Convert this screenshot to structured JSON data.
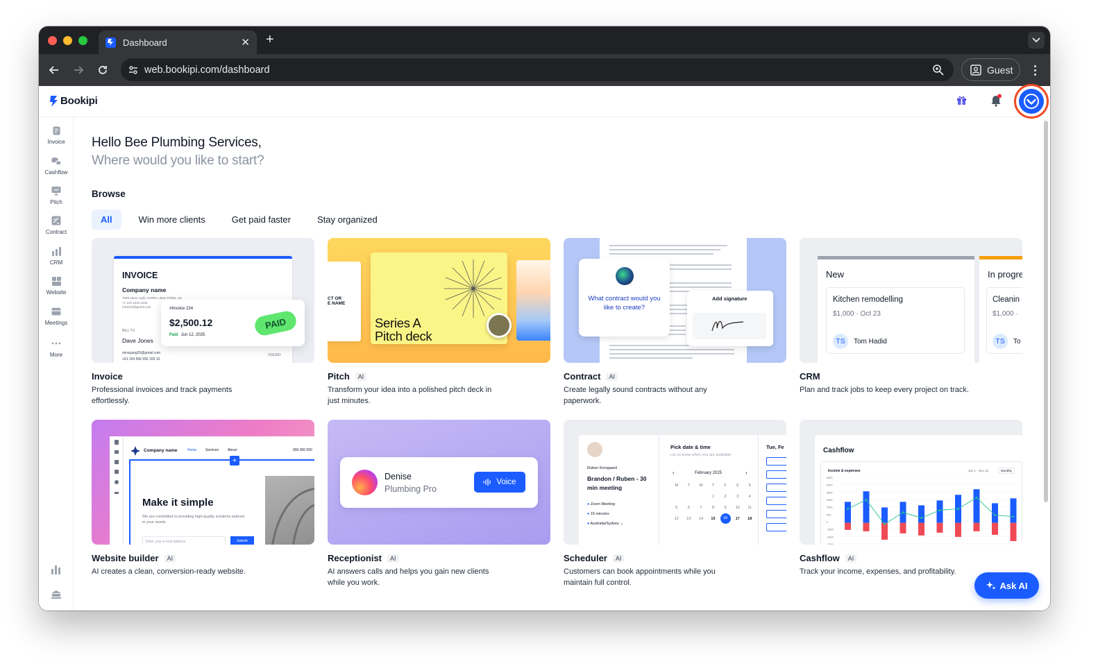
{
  "browser": {
    "tab_title": "Dashboard",
    "url": "web.bookipi.com/dashboard",
    "guest_label": "Guest"
  },
  "app": {
    "logo": "Bookipi"
  },
  "sidebar": {
    "items": [
      {
        "label": "Invoice",
        "icon": "invoice-icon"
      },
      {
        "label": "Cashflow",
        "icon": "cashflow-icon"
      },
      {
        "label": "Pitch",
        "icon": "pitch-icon"
      },
      {
        "label": "Contract",
        "icon": "contract-icon"
      },
      {
        "label": "CRM",
        "icon": "crm-icon"
      },
      {
        "label": "Website",
        "icon": "website-icon"
      },
      {
        "label": "Meetings",
        "icon": "meetings-icon"
      },
      {
        "label": "More",
        "icon": "more-icon"
      }
    ]
  },
  "main": {
    "greeting": "Hello Bee Plumbing Services,",
    "subgreeting": "Where would you like to start?",
    "browse_label": "Browse",
    "filters": [
      "All",
      "Win more clients",
      "Get paid faster",
      "Stay organized"
    ],
    "cards": [
      {
        "title": "Invoice",
        "ai": "",
        "desc": "Professional invoices and track payments effortlessly."
      },
      {
        "title": "Pitch",
        "ai": "AI",
        "desc": "Transform your idea into a polished pitch deck in just minutes."
      },
      {
        "title": "Contract",
        "ai": "AI",
        "desc": "Create legally sound contracts without any paperwork."
      },
      {
        "title": "CRM",
        "ai": "",
        "desc": "Plan and track jobs to keep every project on track."
      },
      {
        "title": "Website builder",
        "ai": "AI",
        "desc": "AI creates a clean, conversion-ready website."
      },
      {
        "title": "Receptionist",
        "ai": "AI",
        "desc": "AI answers calls and helps you gain new clients while you work."
      },
      {
        "title": "Scheduler",
        "ai": "AI",
        "desc": "Customers can book appointments while you maintain full control."
      },
      {
        "title": "Cashflow",
        "ai": "AI",
        "desc": "Track your income, expenses, and profitability."
      }
    ]
  },
  "previews": {
    "invoice": {
      "heading": "INVOICE",
      "company": "Company name",
      "addr1": "7935 Jaron Light, Keeble Lakes 97535, US",
      "addr2": "+1 123 1234 1234",
      "addr3": "mir1234@gmail.com",
      "number": "#Invoice 234",
      "amount": "$2,500.12",
      "paid": "Paid",
      "date": "Jun 12, 2025",
      "stamp": "PAID",
      "bill_to": "BILL TO",
      "client": "Dave Jones",
      "client_email": "miracjang25@gmail.com",
      "client_phone": "+61 154 566 556 165 16",
      "issued": "ISSUED"
    },
    "pitch": {
      "line1": "Series A",
      "line2": "Pitch deck",
      "side1": "CT OR",
      "side2": "E NAME"
    },
    "contract": {
      "question": "What contract would you like to create?",
      "sign": "Add signature"
    },
    "crm": {
      "col1": "New",
      "col2": "In progre",
      "job1": "Kitchen remodelling",
      "job1_meta": "$1,000 · Oct 23",
      "avatar1": "TS",
      "person1": "Tom Hadid",
      "job2": "Cleanin",
      "job2_meta": "$1,000 ·",
      "avatar2": "TS",
      "person2": "To"
    },
    "website": {
      "company": "Company name",
      "nav1": "Home",
      "nav2": "Services",
      "nav3": "About",
      "phone": "000 000 000",
      "headline": "Make it simple",
      "body": "We are committed to providing high-quality solutions tailored to your needs.",
      "placeholder": "Enter your e-mail address",
      "submit": "Submit"
    },
    "receptionist": {
      "name": "Denise",
      "role": "Plumbing Pro",
      "voice": "Voice"
    },
    "scheduler": {
      "host": "Ruben Korsgaard",
      "event": "Brandon / Ruben - 30 min meeting",
      "loc": "Zoom Meeting",
      "dur": "15 minutes",
      "tz": "Australia/Sydney",
      "pick": "Pick date & time",
      "pick_sub": "Let us know when you are available.",
      "month": "February 2025",
      "side": "Tue, Fe",
      "dow": [
        "M",
        "T",
        "W",
        "T",
        "F",
        "S",
        "S"
      ],
      "days": [
        "",
        "",
        "",
        "1",
        "2",
        "3",
        "4",
        "5",
        "6",
        "7",
        "8",
        "9",
        "10",
        "11",
        "12",
        "13",
        "14",
        "15",
        "16",
        "17",
        "18"
      ]
    },
    "cashflow": {
      "title": "Cashflow",
      "panel": "Income & expenses",
      "range": "Jan 1 - Dec 31",
      "period": "Monthly",
      "yticks": [
        "6500",
        "5000",
        "3500",
        "2500",
        "1500",
        "500",
        "0",
        "-1500",
        "-2400",
        "-3000"
      ]
    }
  },
  "ask_ai": "Ask AI",
  "colors": {
    "brand": "#1a5cff",
    "profile_ring": "#f04a23",
    "paid_green": "#5ee66e",
    "income": "#1a5cff",
    "expense": "#f04a55",
    "net": "#22c08f"
  },
  "chart_data": {
    "type": "bar",
    "title": "Income & expenses",
    "series": [
      {
        "name": "",
        "values": [
          3000,
          4500,
          2200,
          3000,
          2500,
          3200,
          4000,
          4800,
          2800,
          3500
        ]
      },
      {
        "name": "",
        "values": [
          -1000,
          -1200,
          -2400,
          -1500,
          -1800,
          -1400,
          -2000,
          -1200,
          -1700,
          -2600
        ]
      }
    ]
  }
}
